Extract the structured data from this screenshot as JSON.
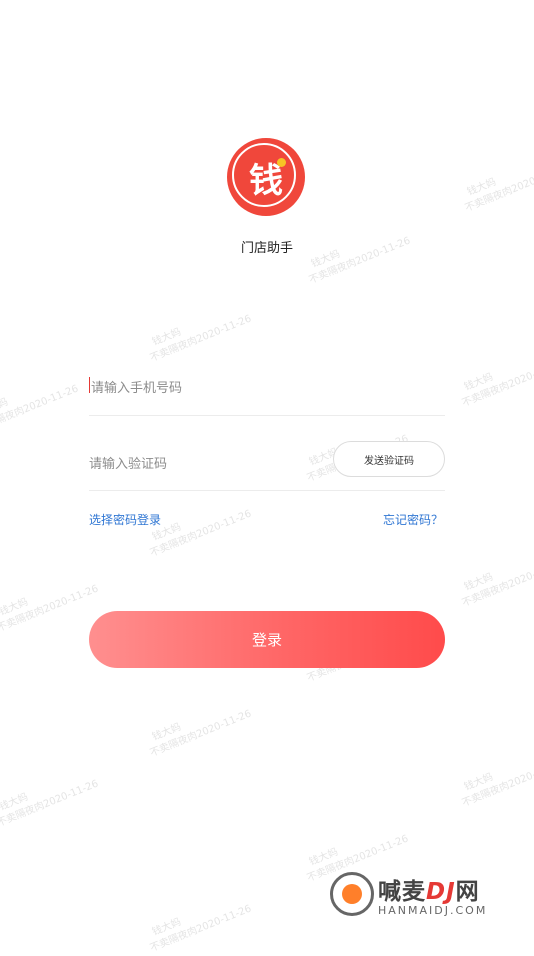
{
  "app": {
    "name": "门店助手",
    "logo_char": "钱"
  },
  "login": {
    "phone_placeholder": "请输入手机号码",
    "code_placeholder": "请输入验证码",
    "send_code_label": "发送验证码",
    "password_login_link": "选择密码登录",
    "forgot_password_link": "忘记密码？",
    "login_button": "登录"
  },
  "watermark": {
    "line1": "钱大妈",
    "line2": "不卖隔夜肉2020-11-26"
  },
  "site_watermark": {
    "name_part1": "喊麦",
    "name_part2": "DJ",
    "name_part3": "网",
    "url": "HANMAIDJ.COM"
  },
  "colors": {
    "brand": "#f0473b",
    "link": "#2f76d3",
    "button_start": "#ff8f8f",
    "button_end": "#ff4b4b"
  }
}
